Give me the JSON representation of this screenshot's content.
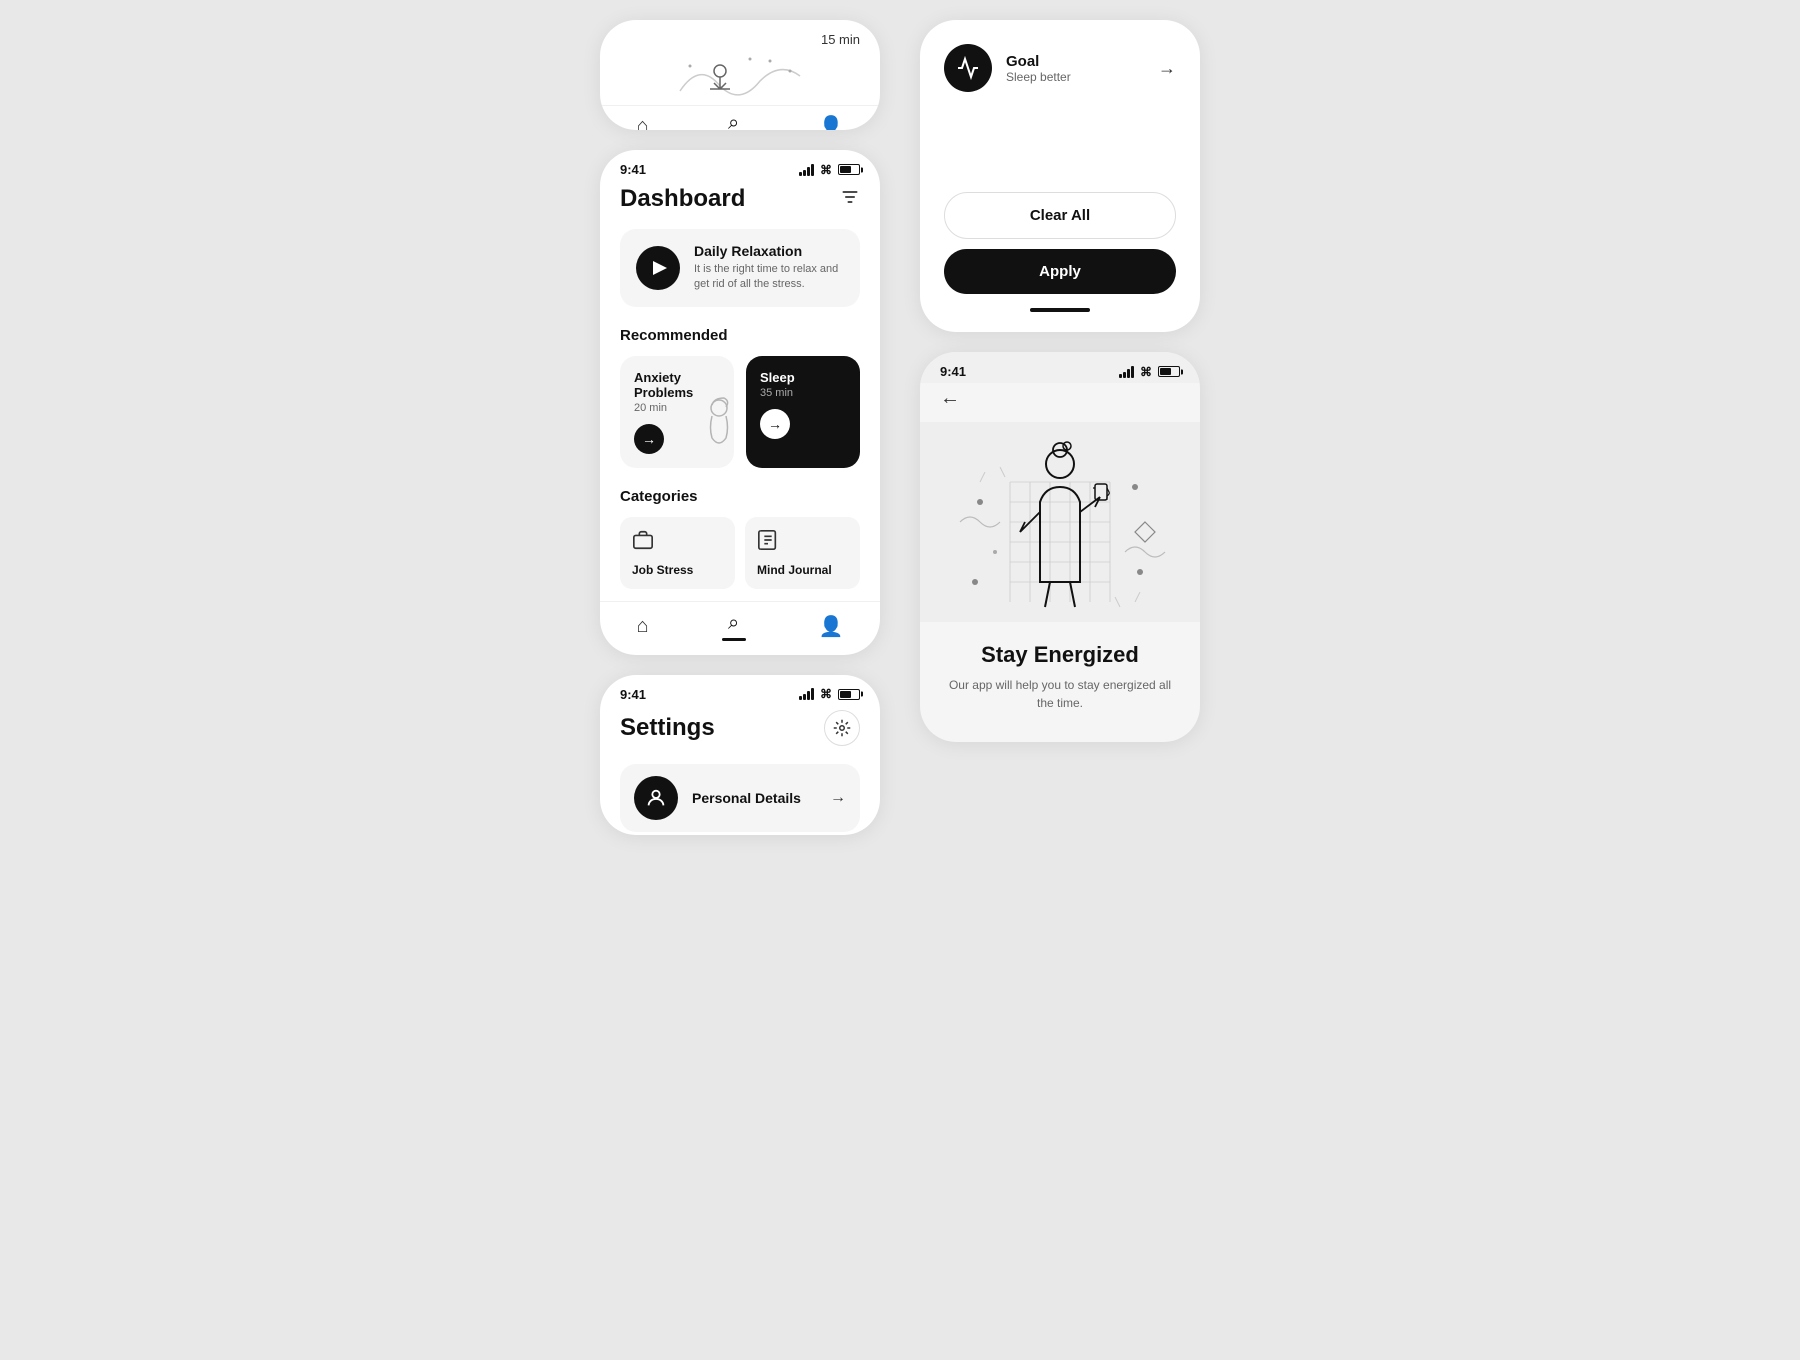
{
  "left_col": {
    "phone_partial": {
      "time": "15 min"
    },
    "phone_dashboard": {
      "status_time": "9:41",
      "title": "Dashboard",
      "relaxation": {
        "title": "Daily Relaxation",
        "description": "It is the right time to relax and get rid of all the stress."
      },
      "recommended_label": "Recommended",
      "recommended": [
        {
          "title": "Anxiety Problems",
          "duration": "20 min"
        },
        {
          "title": "Sleep",
          "duration": "35 min"
        }
      ],
      "categories_label": "Categories",
      "categories": [
        {
          "name": "Job Stress",
          "icon": "💼"
        },
        {
          "name": "Mind Journal",
          "icon": "📓"
        }
      ]
    },
    "phone_settings": {
      "status_time": "9:41",
      "title": "Settings",
      "personal_details_label": "Personal Details"
    }
  },
  "right_col": {
    "filter_panel": {
      "goal_title": "Goal",
      "goal_subtitle": "Sleep better",
      "clear_all_label": "Clear All",
      "apply_label": "Apply"
    },
    "stay_energized": {
      "status_time": "9:41",
      "title": "Stay Energized",
      "description": "Our app will help you to stay energized all the time."
    }
  }
}
